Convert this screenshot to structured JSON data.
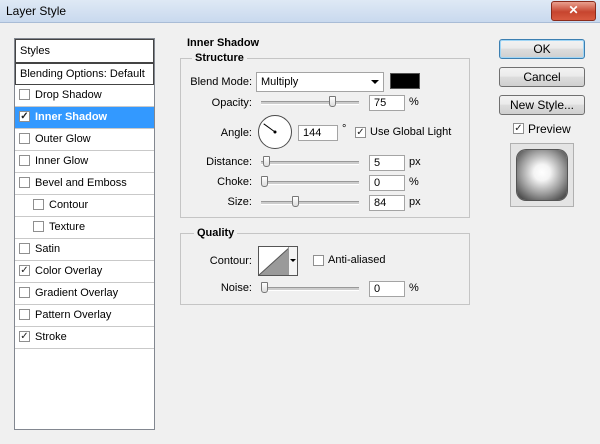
{
  "window": {
    "title": "Layer Style",
    "close_glyph": "✕"
  },
  "styles_list": {
    "header": "Styles",
    "items": [
      {
        "label": "Blending Options: Default",
        "checkbox": false,
        "checked": false
      },
      {
        "label": "Drop Shadow",
        "checkbox": true,
        "checked": false
      },
      {
        "label": "Inner Shadow",
        "checkbox": true,
        "checked": true,
        "selected": true
      },
      {
        "label": "Outer Glow",
        "checkbox": true,
        "checked": false
      },
      {
        "label": "Inner Glow",
        "checkbox": true,
        "checked": false
      },
      {
        "label": "Bevel and Emboss",
        "checkbox": true,
        "checked": false
      },
      {
        "label": "Contour",
        "checkbox": true,
        "checked": false,
        "sub": true
      },
      {
        "label": "Texture",
        "checkbox": true,
        "checked": false,
        "sub": true
      },
      {
        "label": "Satin",
        "checkbox": true,
        "checked": false
      },
      {
        "label": "Color Overlay",
        "checkbox": true,
        "checked": true
      },
      {
        "label": "Gradient Overlay",
        "checkbox": true,
        "checked": false
      },
      {
        "label": "Pattern Overlay",
        "checkbox": true,
        "checked": false
      },
      {
        "label": "Stroke",
        "checkbox": true,
        "checked": true
      }
    ]
  },
  "inner_shadow": {
    "title": "Inner Shadow",
    "structure": {
      "title": "Structure",
      "blend_mode_label": "Blend Mode:",
      "blend_mode_value": "Multiply",
      "shadow_color": "#000000",
      "opacity_label": "Opacity:",
      "opacity_value": "75",
      "opacity_unit": "%",
      "opacity_fraction": 0.75,
      "angle_label": "Angle:",
      "angle_value": "144",
      "angle_unit": "°",
      "angle_degrees": 144,
      "global_light_label": "Use Global Light",
      "global_light_checked": true,
      "distance_label": "Distance:",
      "distance_value": "5",
      "distance_unit": "px",
      "distance_fraction": 0.02,
      "choke_label": "Choke:",
      "choke_value": "0",
      "choke_unit": "%",
      "choke_fraction": 0,
      "size_label": "Size:",
      "size_value": "84",
      "size_unit": "px",
      "size_fraction": 0.34
    },
    "quality": {
      "title": "Quality",
      "contour_label": "Contour:",
      "anti_aliased_label": "Anti-aliased",
      "anti_aliased_checked": false,
      "noise_label": "Noise:",
      "noise_value": "0",
      "noise_unit": "%",
      "noise_fraction": 0
    }
  },
  "buttons": {
    "ok": "OK",
    "cancel": "Cancel",
    "new_style": "New Style..."
  },
  "preview": {
    "label": "Preview",
    "checked": true
  }
}
